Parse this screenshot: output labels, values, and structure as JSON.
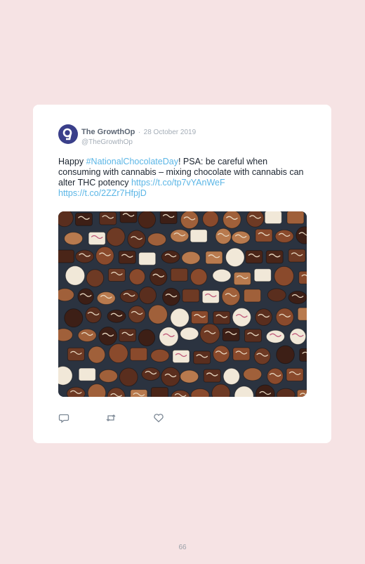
{
  "tweet": {
    "display_name": "The GrowthOp",
    "separator": "·",
    "date": "28 October 2019",
    "handle": "@TheGrowthOp",
    "text_1": "Happy ",
    "hashtag": "#NationalChocolateDay",
    "text_2": "! PSA: be careful when consuming with cannabis –  mixing chocolate with cannabis can alter THC potency ",
    "link_1": "https://t.co/tp7vYAnWeF",
    "link_2": "https://t.co/2ZZr7HfpjD",
    "image_subject": "assorted chocolates",
    "colors": {
      "link": "#5bb6e6",
      "background": "#f6e3e4",
      "avatar": "#3a3f8a"
    }
  },
  "actions": {
    "reply_icon": "reply-icon",
    "retweet_icon": "retweet-icon",
    "like_icon": "heart-icon"
  },
  "page": {
    "number": "66"
  }
}
